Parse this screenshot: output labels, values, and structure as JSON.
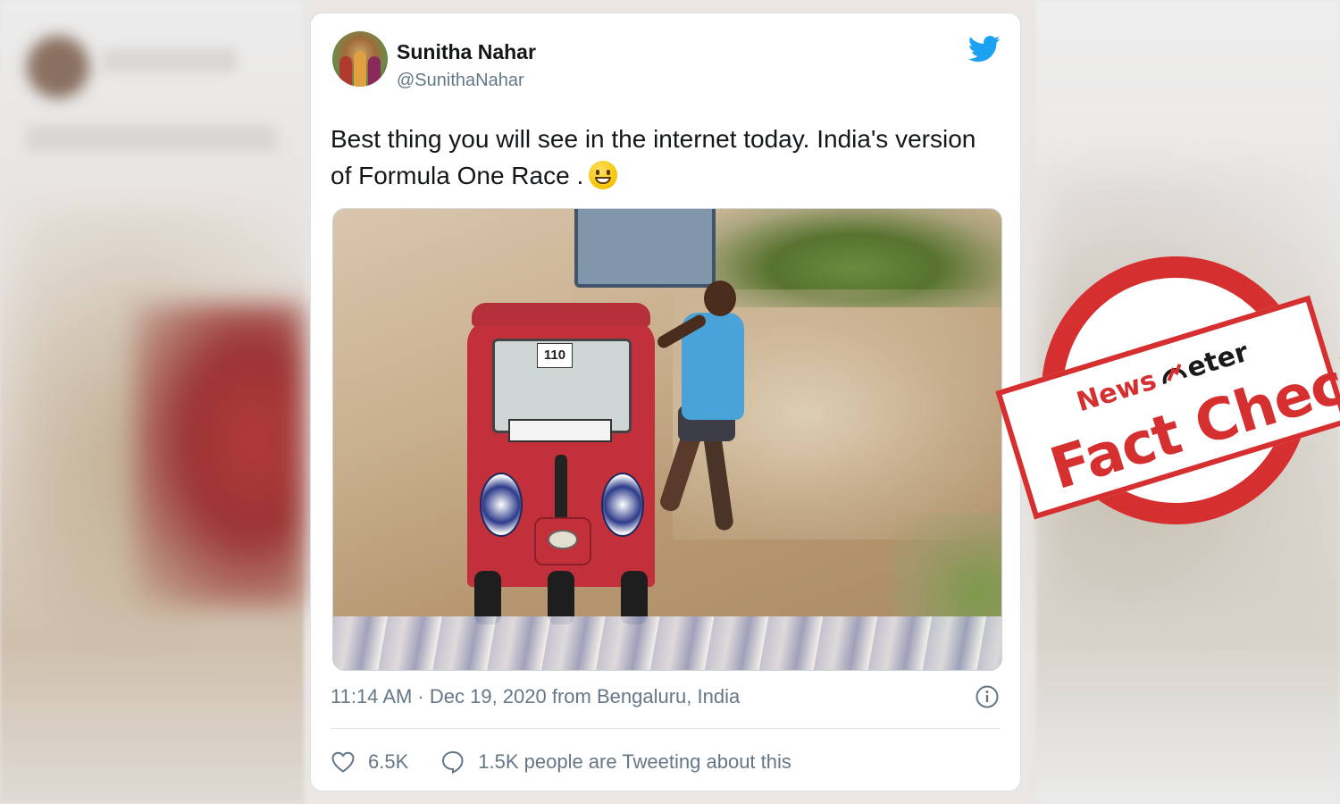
{
  "tweet": {
    "display_name": "Sunitha Nahar",
    "handle": "@SunithaNahar",
    "text_line1": "Best thing you will see in the internet today.  India's version",
    "text_line2": "of Formula One Race .",
    "media_plate": "110",
    "timestamp": "11:14 AM · Dec 19, 2020 from Bengaluru, India",
    "likes": "6.5K",
    "replies_text": "1.5K people are Tweeting about this"
  },
  "stamp": {
    "news_prefix": "News",
    "meter_suffix": "eter",
    "fact_check": "Fact Check"
  },
  "colors": {
    "twitter_blue": "#1da1f2",
    "stamp_red": "#d62f2f",
    "text_primary": "#14171a",
    "text_secondary": "#657786"
  },
  "icons": [
    "twitter-bird-icon",
    "info-icon",
    "heart-icon",
    "reply-bubble-icon",
    "grin-emoji-icon",
    "meter-gauge-icon"
  ]
}
